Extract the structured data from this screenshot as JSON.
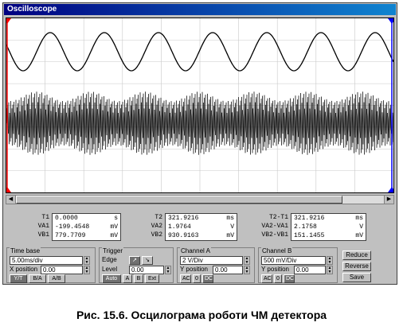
{
  "window": {
    "title": "Oscilloscope"
  },
  "readout": {
    "labels1": [
      "T1",
      "VA1",
      "VB1"
    ],
    "values1": [
      {
        "v": "0.0000",
        "u": "s"
      },
      {
        "v": "-199.4548",
        "u": "mV"
      },
      {
        "v": "779.7709",
        "u": "mV"
      }
    ],
    "labels2": [
      "T2",
      "VA2",
      "VB2"
    ],
    "values2": [
      {
        "v": "321.9216",
        "u": "ms"
      },
      {
        "v": "1.9764",
        "u": "V"
      },
      {
        "v": "930.9163",
        "u": "mV"
      }
    ],
    "labels3": [
      "T2-T1",
      "VA2-VA1",
      "VB2-VB1"
    ],
    "values3": [
      {
        "v": "321.9216",
        "u": "ms"
      },
      {
        "v": "2.1758",
        "u": "V"
      },
      {
        "v": "151.1455",
        "u": "mV"
      }
    ]
  },
  "timebase": {
    "title": "Time base",
    "value": "5.00ms/div",
    "xpos_label": "X position",
    "xpos_value": "0.00",
    "modes": [
      "Y/T",
      "B/A",
      "A/B"
    ]
  },
  "trigger": {
    "title": "Trigger",
    "edge_label": "Edge",
    "level_label": "Level",
    "level_value": "0.00",
    "sources": [
      "Auto",
      "A",
      "B",
      "Ext"
    ]
  },
  "channelA": {
    "title": "Channel A",
    "value": "2 V/Div",
    "ypos_label": "Y position",
    "ypos_value": "0.00",
    "coupling": [
      "AC",
      "0",
      "DC"
    ]
  },
  "channelB": {
    "title": "Channel B",
    "value": "500 mV/Div",
    "ypos_label": "Y position",
    "ypos_value": "0.00",
    "coupling": [
      "AC",
      "0",
      "DC"
    ]
  },
  "buttons": {
    "reduce": "Reduce",
    "reverse": "Reverse",
    "save": "Save"
  },
  "caption": "Рис. 15.6. Осцилограма роботи ЧМ детектора",
  "colors": {
    "title_bar": "#000080",
    "cursor1": "#ff0000",
    "cursor2": "#0000ff",
    "trace": "#000000",
    "grid": "#c8c8c8"
  }
}
